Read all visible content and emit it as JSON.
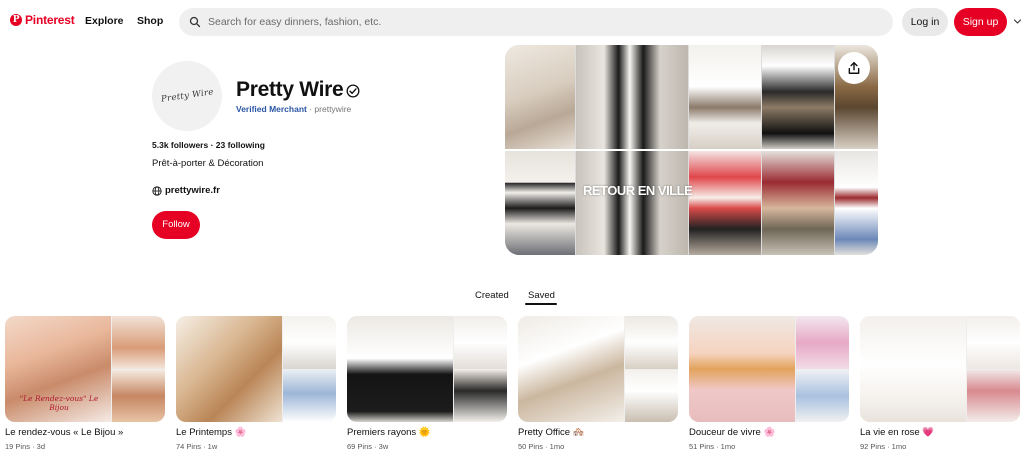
{
  "header": {
    "logo_text": "Pinterest",
    "nav": [
      "Explore",
      "Shop"
    ],
    "search_placeholder": "Search for easy dinners, fashion, etc.",
    "login_label": "Log in",
    "signup_label": "Sign up",
    "brand_color": "#e60023"
  },
  "profile": {
    "name": "Pretty Wire",
    "avatar_text": "Pretty Wire",
    "merchant_label": "Verified Merchant",
    "separator": " · ",
    "handle": "prettywire",
    "stats": "5.3k followers · 23 following",
    "bio": "Prêt-à-porter & Décoration",
    "website": "prettywire.fr",
    "follow_label": "Follow"
  },
  "cover": {
    "overlay_title": "RETOUR EN VILLE"
  },
  "tabs": [
    {
      "label": "Created",
      "active": false
    },
    {
      "label": "Saved",
      "active": true
    }
  ],
  "boards": [
    {
      "name": "Le rendez-vous « Le Bijou »",
      "meta": "19 Pins · 3d",
      "image_caption": "\"Le Rendez-vous\" Le Bijou"
    },
    {
      "name": "Le Printemps 🌸",
      "meta": "74 Pins · 1w"
    },
    {
      "name": "Premiers rayons 🌞",
      "meta": "69 Pins · 3w"
    },
    {
      "name": "Pretty Office 🏘️",
      "meta": "50 Pins · 1mo"
    },
    {
      "name": "Douceur de vivre 🌸",
      "meta": "51 Pins · 1mo"
    },
    {
      "name": "La vie en rose 💗",
      "meta": "92 Pins · 1mo"
    }
  ]
}
